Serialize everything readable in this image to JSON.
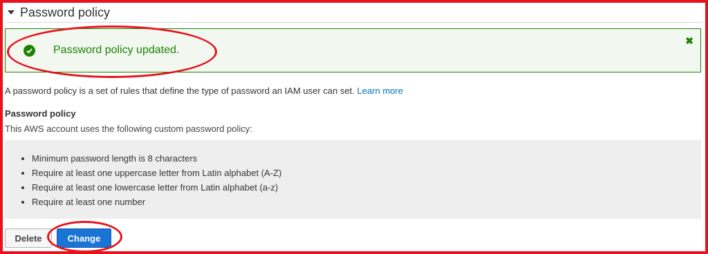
{
  "section": {
    "title": "Password policy"
  },
  "alert": {
    "message": "Password policy updated.",
    "dismiss_icon": "close-icon",
    "status_icon": "check-circle-icon",
    "color": "#1d8102"
  },
  "description": {
    "text": "A password policy is a set of rules that define the type of password an IAM user can set.",
    "link_label": "Learn more"
  },
  "policy": {
    "heading": "Password policy",
    "intro": "This AWS account uses the following custom password policy:",
    "rules": [
      "Minimum password length is 8 characters",
      "Require at least one uppercase letter from Latin alphabet (A-Z)",
      "Require at least one lowercase letter from Latin alphabet (a-z)",
      "Require at least one number"
    ]
  },
  "actions": {
    "delete_label": "Delete",
    "change_label": "Change"
  },
  "colors": {
    "annotation_red": "#e8121b",
    "primary_button": "#1a73d6",
    "link": "#0073bb"
  }
}
